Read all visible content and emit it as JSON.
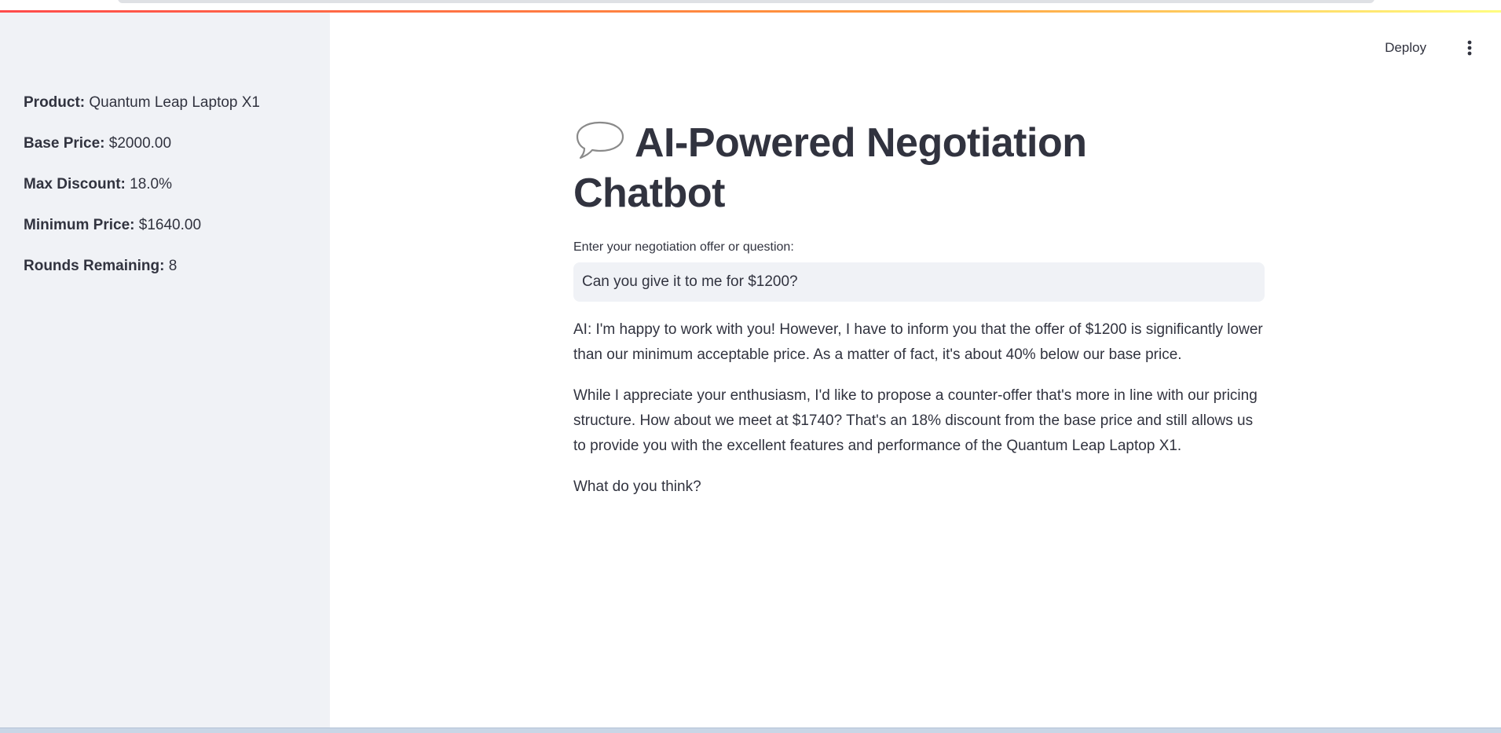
{
  "sidebar": {
    "product_label": "Product:",
    "product_value": "Quantum Leap Laptop X1",
    "base_price_label": "Base Price:",
    "base_price_value": "$2000.00",
    "max_discount_label": "Max Discount:",
    "max_discount_value": "18.0%",
    "min_price_label": "Minimum Price:",
    "min_price_value": "$1640.00",
    "rounds_label": "Rounds Remaining:",
    "rounds_value": "8"
  },
  "header": {
    "deploy_label": "Deploy",
    "menu_icon": "vertical-ellipsis-icon"
  },
  "main": {
    "title_icon": "speech-bubble-icon",
    "title_line1": "AI-Powered Negotiation",
    "title_line2": "Chatbot",
    "input_label": "Enter your negotiation offer or question:",
    "input_value": "Can you give it to me for $1200?",
    "response_paragraphs": [
      "AI: I'm happy to work with you! However, I have to inform you that the offer of $1200 is significantly lower than our minimum acceptable price. As a matter of fact, it's about 40% below our base price.",
      "While I appreciate your enthusiasm, I'd like to propose a counter-offer that's more in line with our pricing structure. How about we meet at $1740? That's an 18% discount from the base price and still allows us to provide you with the excellent features and performance of the Quantum Leap Laptop X1.",
      "What do you think?"
    ]
  },
  "colors": {
    "text": "#31333f",
    "sidebar_bg": "#f0f2f6",
    "input_bg": "#f0f2f6",
    "decoration_start": "#ff4b4b",
    "decoration_end": "#fffd80"
  }
}
